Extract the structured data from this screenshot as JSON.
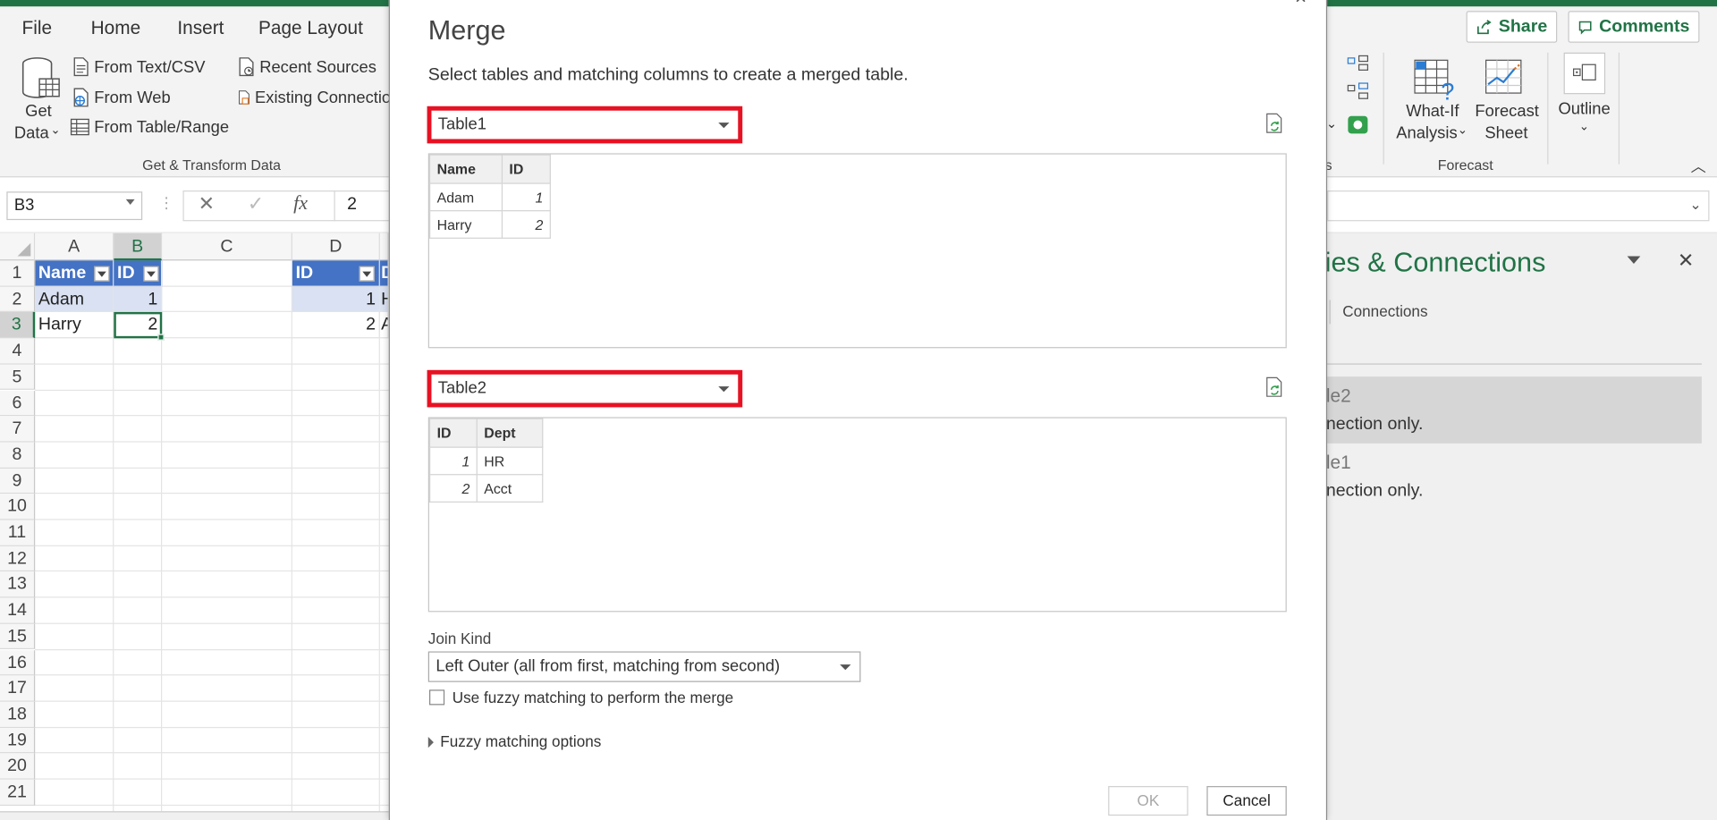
{
  "ribbon": {
    "tabs": [
      "File",
      "Home",
      "Insert",
      "Page Layout"
    ],
    "share_label": "Share",
    "comments_label": "Comments",
    "get_data_line1": "Get",
    "get_data_line2": "Data",
    "from_text_csv": "From Text/CSV",
    "from_web": "From Web",
    "from_table_range": "From Table/Range",
    "recent_sources": "Recent Sources",
    "existing_connections": "Existing Connectio",
    "group_get_transform": "Get & Transform Data",
    "what_if_line1": "What-If",
    "what_if_line2": "Analysis",
    "forecast_sheet_line1": "Forecast",
    "forecast_sheet_line2": "Sheet",
    "outline_label": "Outline",
    "group_forecast": "Forecast",
    "group_partial": "s"
  },
  "formula_bar": {
    "name_box": "B3",
    "value": "2"
  },
  "sheet": {
    "columns": [
      "A",
      "B",
      "C",
      "D"
    ],
    "rows": [
      "1",
      "2",
      "3",
      "4",
      "5",
      "6",
      "7",
      "8",
      "9",
      "10",
      "11",
      "12",
      "13",
      "14",
      "15",
      "16",
      "17",
      "18",
      "19",
      "20",
      "21"
    ],
    "table1": {
      "headers": [
        "Name",
        "ID"
      ],
      "rows": [
        [
          "Adam",
          "1"
        ],
        [
          "Harry",
          "2"
        ]
      ]
    },
    "table2": {
      "headers": [
        "ID",
        "D"
      ],
      "rows": [
        [
          "1",
          "H"
        ],
        [
          "2",
          "A"
        ]
      ]
    }
  },
  "queries_pane": {
    "title": "ies & Connections",
    "tab_connections": "Connections",
    "items": [
      {
        "name": "le2",
        "status": "nection only."
      },
      {
        "name": "le1",
        "status": "nection only."
      }
    ]
  },
  "dialog": {
    "title": "Merge",
    "description": "Select tables and matching columns to create a merged table.",
    "table1_select": "Table1",
    "table2_select": "Table2",
    "preview1": {
      "headers": [
        "Name",
        "ID"
      ],
      "rows": [
        [
          "Adam",
          "1"
        ],
        [
          "Harry",
          "2"
        ]
      ]
    },
    "preview2": {
      "headers": [
        "ID",
        "Dept"
      ],
      "rows": [
        [
          "1",
          "HR"
        ],
        [
          "2",
          "Acct"
        ]
      ]
    },
    "join_kind_label": "Join Kind",
    "join_kind_value": "Left Outer (all from first, matching from second)",
    "fuzzy_checkbox_label": "Use fuzzy matching to perform the merge",
    "fuzzy_options_label": "Fuzzy matching options",
    "ok_label": "OK",
    "cancel_label": "Cancel"
  },
  "colors": {
    "excel_green": "#217346",
    "table_header": "#4472c4",
    "table_band": "#d9e1f2",
    "highlight_red": "#e81123"
  }
}
